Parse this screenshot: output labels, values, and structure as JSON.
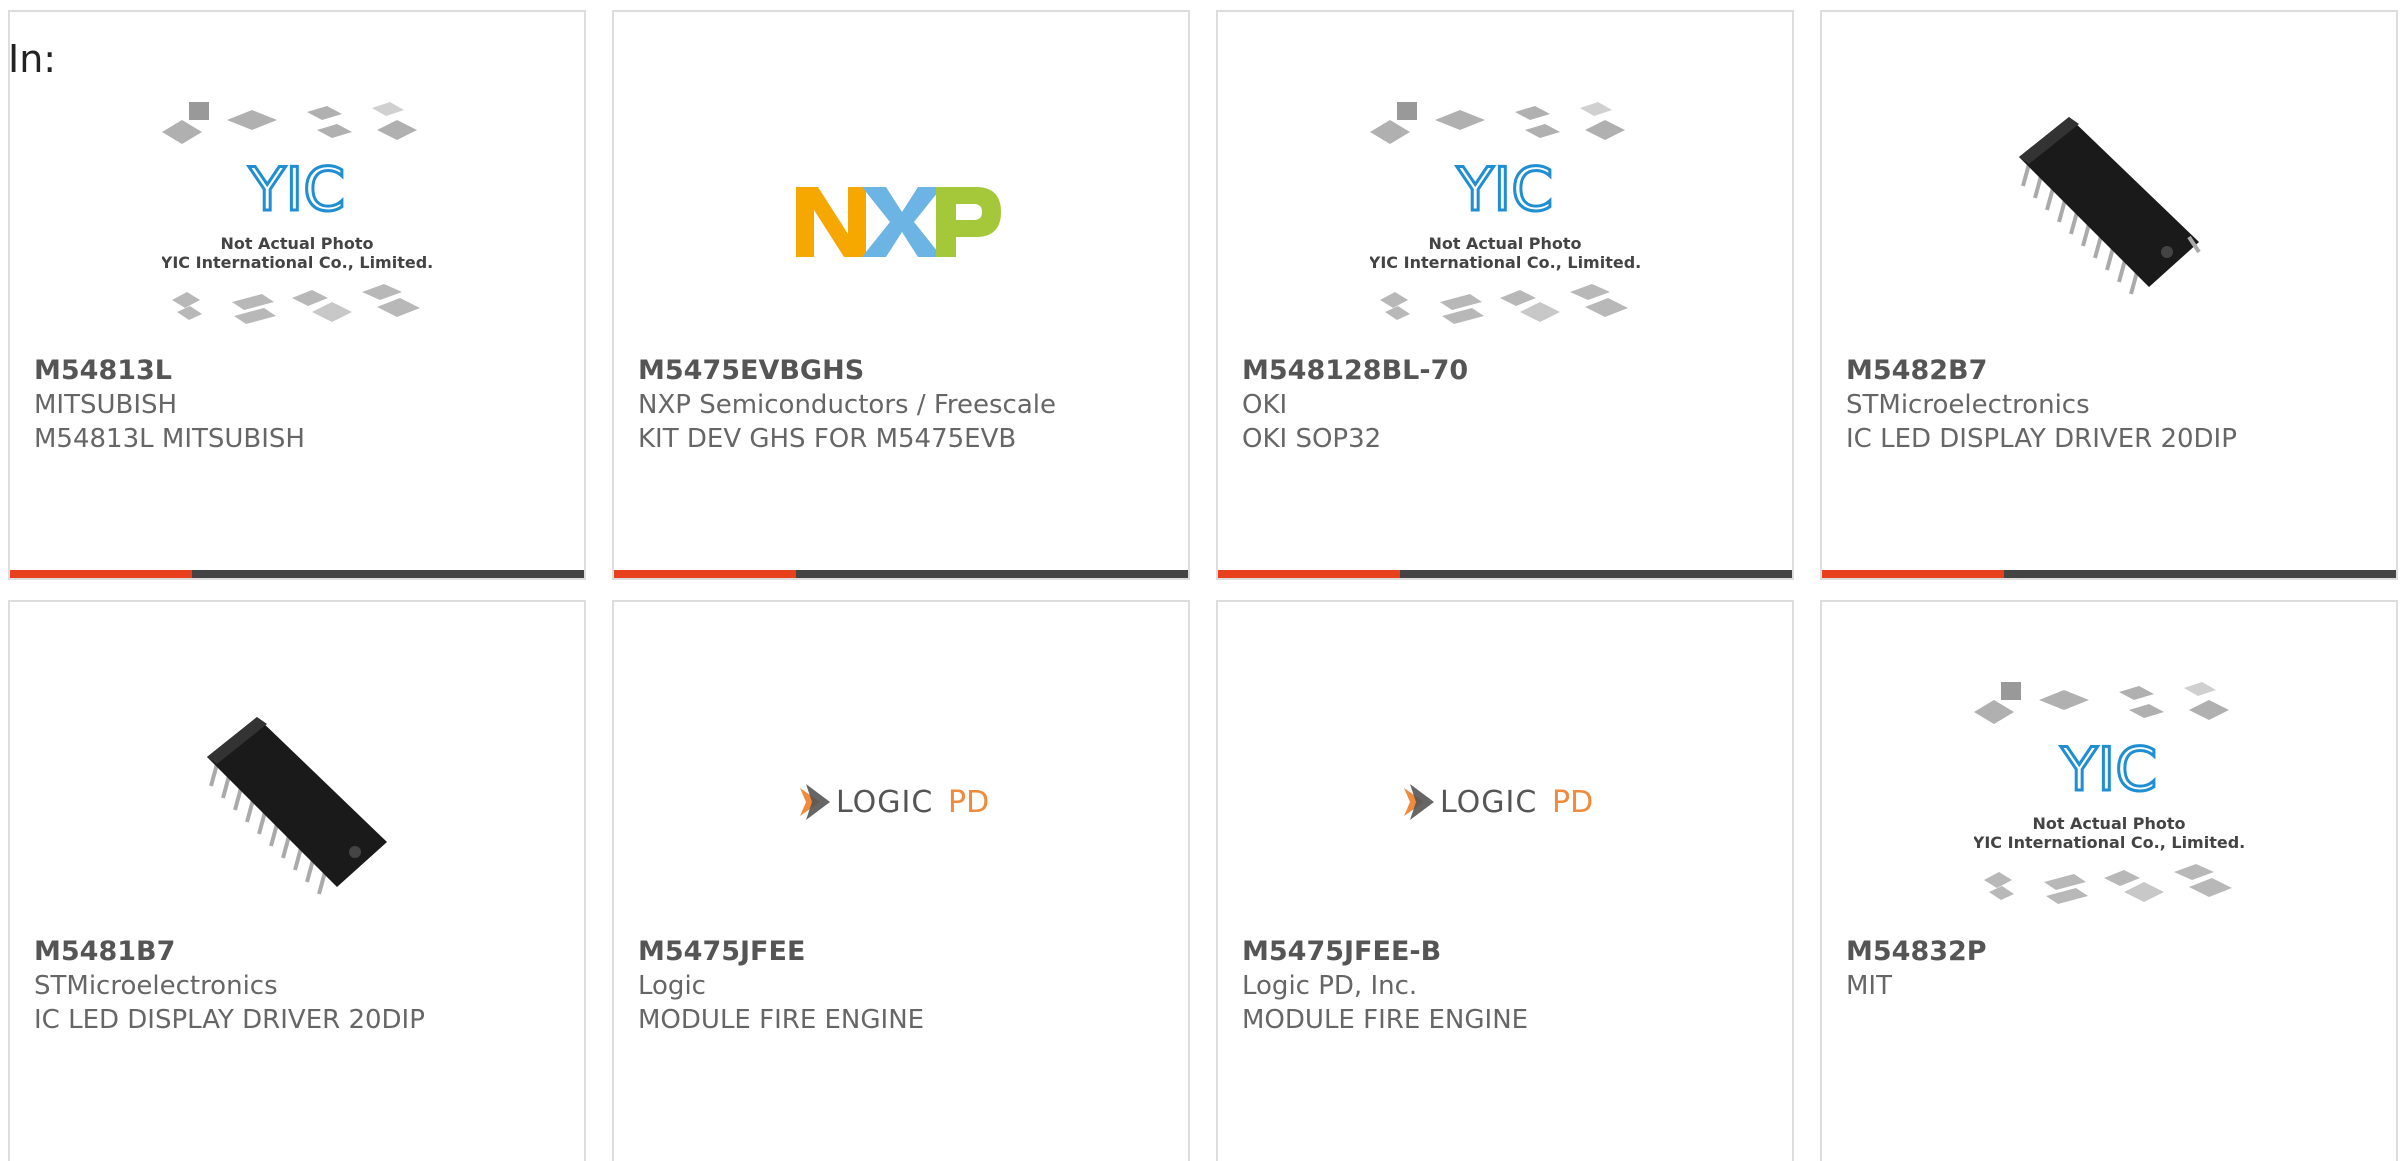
{
  "filter_label": "In:",
  "colors": {
    "accent": "#e8401c",
    "bar": "#444444",
    "nxp_orange": "#f6a800",
    "nxp_blue": "#6cb4e4",
    "nxp_green": "#a5c83b",
    "logic_orange": "#f08a3c"
  },
  "placeholder_image": {
    "line1": "Not Actual Photo",
    "line2": "YIC International Co., Limited.",
    "logo_text": "YIC"
  },
  "logos": {
    "nxp": "NXP",
    "logicpd_main": "LOGIC",
    "logicpd_suffix": "PD"
  },
  "products": [
    {
      "part": "M54813L",
      "manufacturer": "MITSUBISH",
      "description": "M54813L MITSUBISH",
      "image": "yic-placeholder"
    },
    {
      "part": "M5475EVBGHS",
      "manufacturer": "NXP Semiconductors / Freescale",
      "description": "KIT DEV GHS FOR M5475EVB",
      "image": "nxp-logo"
    },
    {
      "part": "M548128BL-70",
      "manufacturer": "OKI",
      "description": "OKI SOP32",
      "image": "yic-placeholder"
    },
    {
      "part": "M5482B7",
      "manufacturer": "STMicroelectronics",
      "description": "IC LED DISPLAY DRIVER 20DIP",
      "image": "dip-chip"
    },
    {
      "part": "M5481B7",
      "manufacturer": "STMicroelectronics",
      "description": "IC LED DISPLAY DRIVER 20DIP",
      "image": "dip-chip"
    },
    {
      "part": "M5475JFEE",
      "manufacturer": "Logic",
      "description": "MODULE FIRE ENGINE",
      "image": "logicpd-logo"
    },
    {
      "part": "M5475JFEE-B",
      "manufacturer": "Logic PD, Inc.",
      "description": "MODULE FIRE ENGINE",
      "image": "logicpd-logo"
    },
    {
      "part": "M54832P",
      "manufacturer": "MIT",
      "description": "",
      "image": "yic-placeholder"
    }
  ]
}
